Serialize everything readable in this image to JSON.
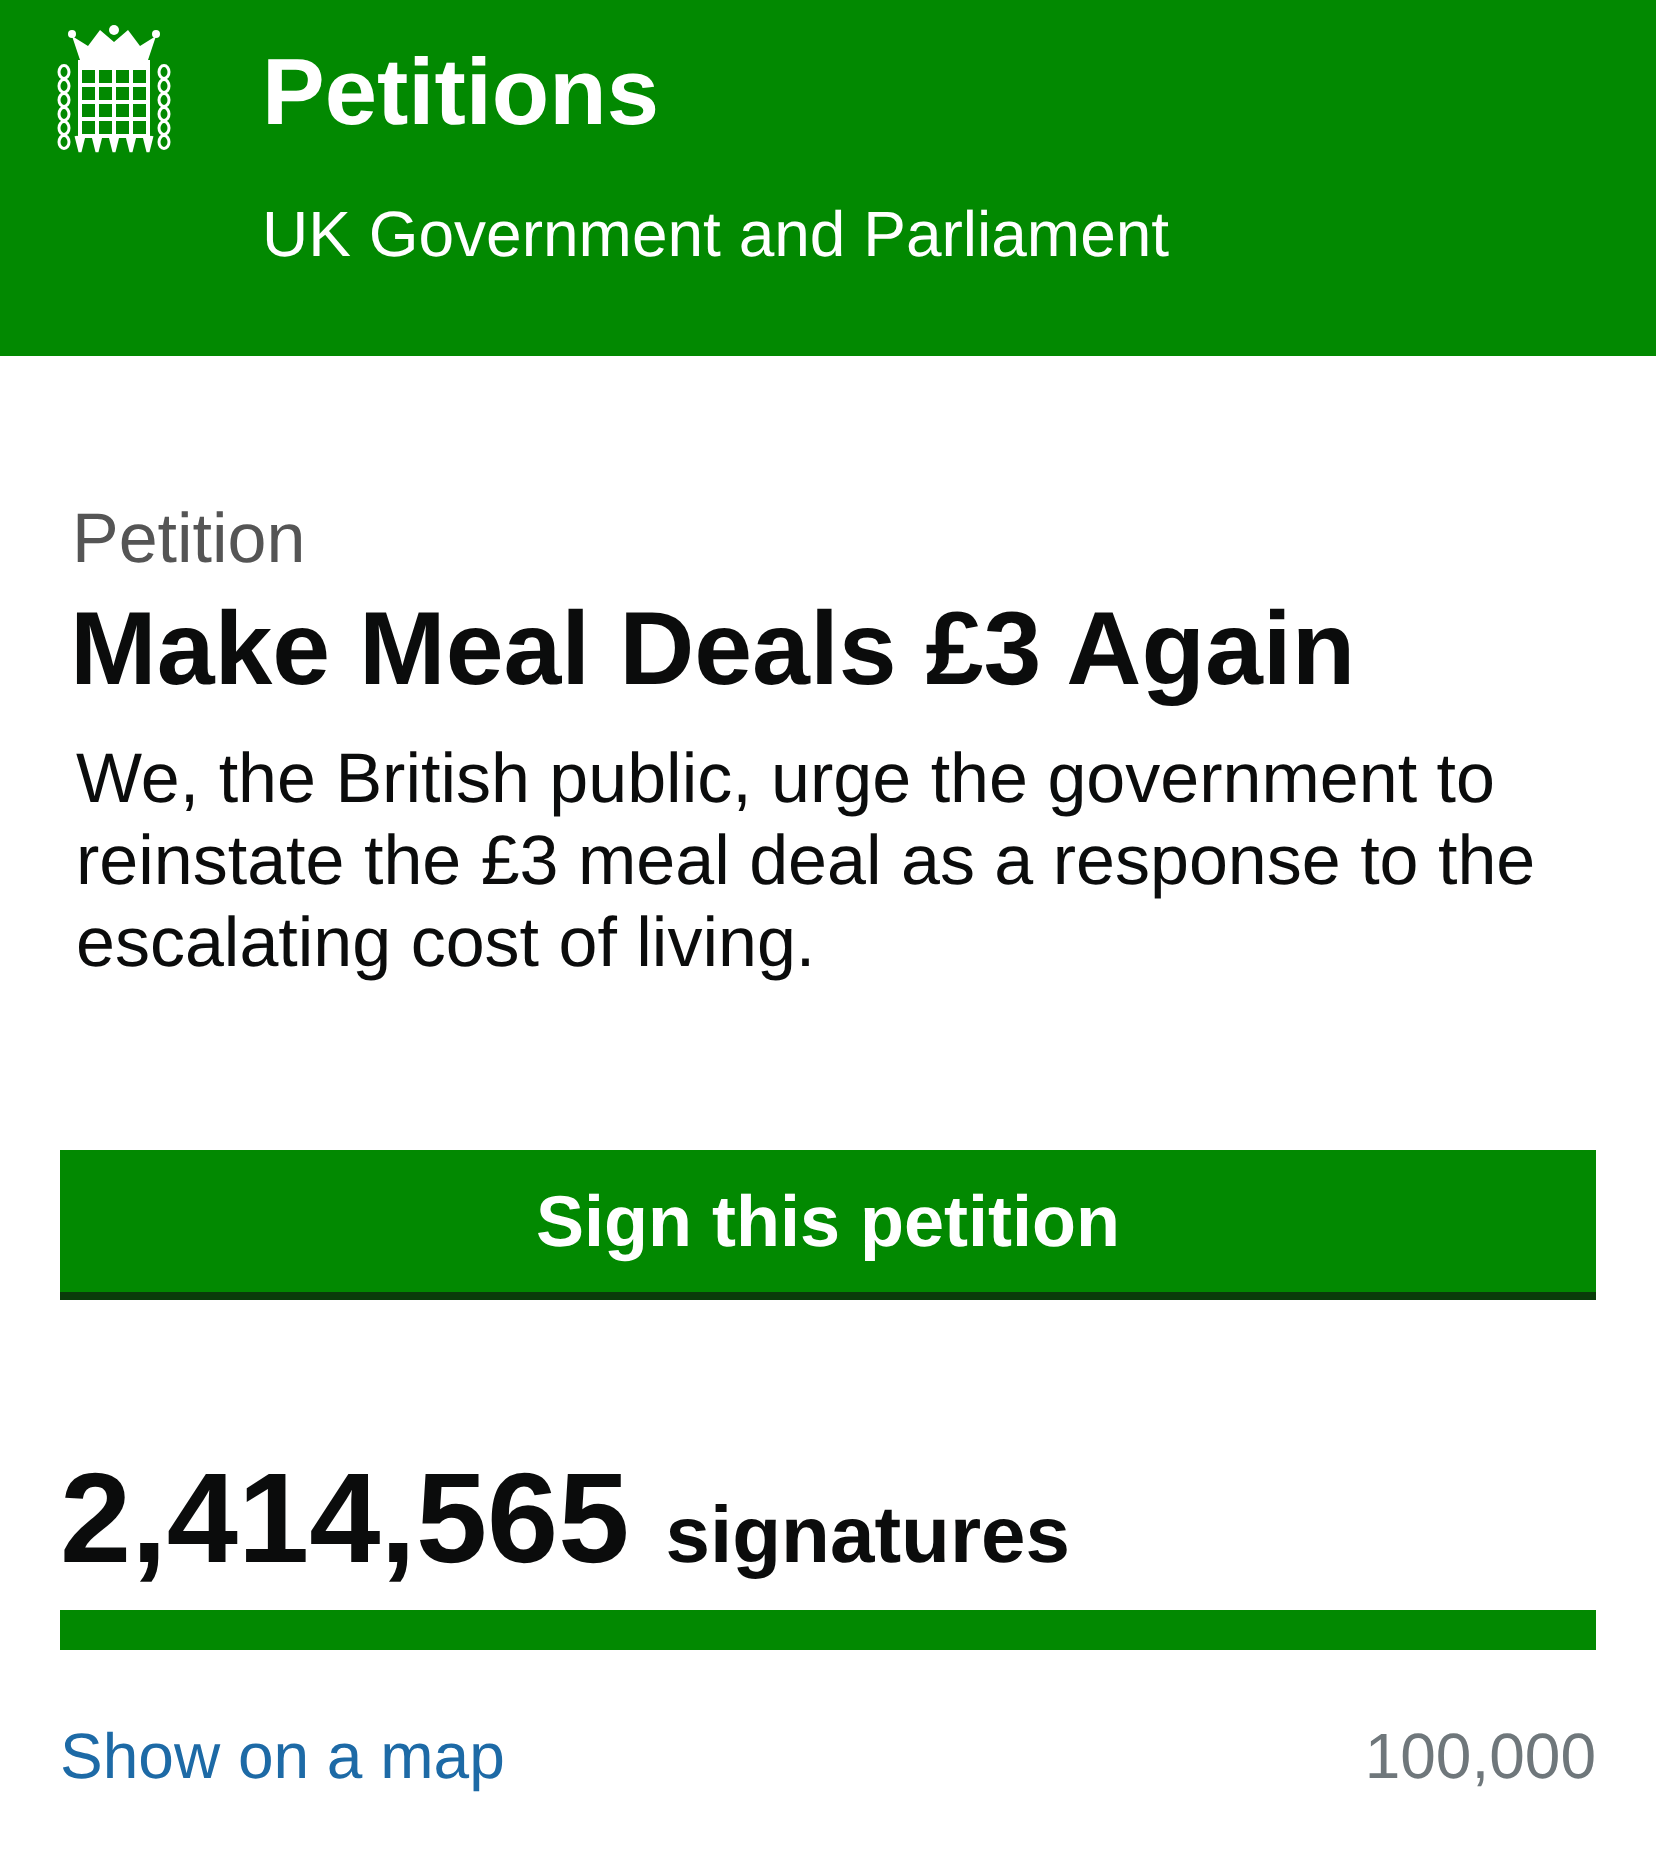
{
  "header": {
    "title": "Petitions",
    "subtitle": "UK Government and Parliament"
  },
  "petition": {
    "label": "Petition",
    "title": "Make Meal Deals £3 Again",
    "description": "We, the British public, urge the government to reinstate the £3 meal deal as a response to the escalating cost of living."
  },
  "sign_button": {
    "label": "Sign this petition"
  },
  "signatures": {
    "count": "2,414,565",
    "unit": "signatures",
    "progress": {
      "level": 1
    },
    "map_link": "Show on a map",
    "threshold": "100,000"
  }
}
